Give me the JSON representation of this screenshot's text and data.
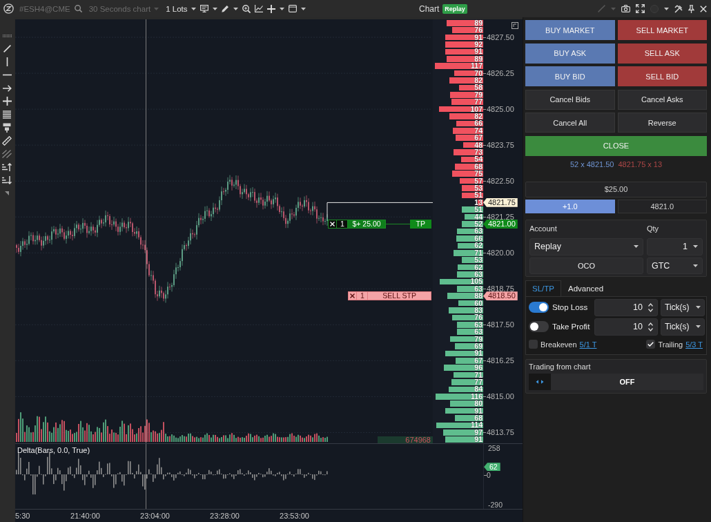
{
  "toolbar": {
    "symbol": {
      "text": "#ESH4@CME",
      "disabled": true
    },
    "timeframe": {
      "text": "30 Seconds chart",
      "disabled": true
    },
    "lots": {
      "text": "1 Lots",
      "disabled": false
    },
    "title": "Chart",
    "mode_badge": "Replay"
  },
  "chart": {
    "ladder": [
      {
        "volume": "89",
        "kind": "ask",
        "level": 0.76
      },
      {
        "volume": "76",
        "kind": "ask",
        "level": 0.65
      },
      {
        "volume": "91",
        "kind": "ask",
        "level": 0.78,
        "axis_label": {
          "text": "4827.50",
          "kind": "tick"
        }
      },
      {
        "volume": "92",
        "kind": "ask",
        "level": 0.79
      },
      {
        "volume": "91",
        "kind": "ask",
        "level": 0.78
      },
      {
        "volume": "89",
        "kind": "ask",
        "level": 0.76
      },
      {
        "volume": "117",
        "kind": "ask",
        "level": 1.0
      },
      {
        "volume": "70",
        "kind": "ask",
        "level": 0.6,
        "axis_label": {
          "text": "4826.25",
          "kind": "tick"
        }
      },
      {
        "volume": "82",
        "kind": "ask",
        "level": 0.7
      },
      {
        "volume": "58",
        "kind": "ask",
        "level": 0.5
      },
      {
        "volume": "79",
        "kind": "ask",
        "level": 0.68
      },
      {
        "volume": "77",
        "kind": "ask",
        "level": 0.66
      },
      {
        "volume": "107",
        "kind": "ask",
        "level": 0.91,
        "axis_label": {
          "text": "4825.00",
          "kind": "tick"
        }
      },
      {
        "volume": "82",
        "kind": "ask",
        "level": 0.7
      },
      {
        "volume": "66",
        "kind": "ask",
        "level": 0.56
      },
      {
        "volume": "74",
        "kind": "ask",
        "level": 0.63
      },
      {
        "volume": "67",
        "kind": "ask",
        "level": 0.57
      },
      {
        "volume": "48",
        "kind": "ask",
        "level": 0.41,
        "axis_label": {
          "text": "4823.75",
          "kind": "tick"
        }
      },
      {
        "volume": "73",
        "kind": "ask",
        "level": 0.62
      },
      {
        "volume": "54",
        "kind": "ask",
        "level": 0.46
      },
      {
        "volume": "68",
        "kind": "ask",
        "level": 0.58
      },
      {
        "volume": "75",
        "kind": "ask",
        "level": 0.64
      },
      {
        "volume": "57",
        "kind": "ask",
        "level": 0.49,
        "axis_label": {
          "text": "4822.50",
          "kind": "tick"
        }
      },
      {
        "volume": "53",
        "kind": "ask",
        "level": 0.45
      },
      {
        "volume": "51",
        "kind": "ask",
        "level": 0.44
      },
      {
        "volume": "13",
        "kind": "ask",
        "level": 0.11,
        "axis_label": {
          "text": "4821.75",
          "kind": "last"
        }
      },
      {
        "volume": "51",
        "kind": "bid",
        "level": 0.44
      },
      {
        "volume": "44",
        "kind": "bid",
        "level": 0.38,
        "axis_label": {
          "text": "4821.25",
          "kind": "tick"
        }
      },
      {
        "volume": "52",
        "kind": "bid",
        "level": 0.44,
        "axis_label": {
          "text": "4821.00",
          "kind": "take-profit"
        },
        "order": {
          "kind": "take-profit",
          "qty": "1",
          "text": "$+ 25.00",
          "tag": "TP"
        }
      },
      {
        "volume": "63",
        "kind": "bid",
        "level": 0.54
      },
      {
        "volume": "66",
        "kind": "bid",
        "level": 0.56
      },
      {
        "volume": "62",
        "kind": "bid",
        "level": 0.53
      },
      {
        "volume": "71",
        "kind": "bid",
        "level": 0.61,
        "axis_label": {
          "text": "4820.00",
          "kind": "tick"
        }
      },
      {
        "volume": "53",
        "kind": "bid",
        "level": 0.45
      },
      {
        "volume": "62",
        "kind": "bid",
        "level": 0.53
      },
      {
        "volume": "63",
        "kind": "bid",
        "level": 0.54
      },
      {
        "volume": "105",
        "kind": "bid",
        "level": 0.9
      },
      {
        "volume": "63",
        "kind": "bid",
        "level": 0.54,
        "axis_label": {
          "text": "4818.75",
          "kind": "tick"
        }
      },
      {
        "volume": "88",
        "kind": "bid",
        "level": 0.75,
        "axis_label": {
          "text": "4818.50",
          "kind": "stop"
        },
        "order": {
          "kind": "stop",
          "qty": "1",
          "text": "SELL STP"
        }
      },
      {
        "volume": "60",
        "kind": "bid",
        "level": 0.51
      },
      {
        "volume": "83",
        "kind": "bid",
        "level": 0.71
      },
      {
        "volume": "76",
        "kind": "bid",
        "level": 0.65
      },
      {
        "volume": "63",
        "kind": "bid",
        "level": 0.54,
        "axis_label": {
          "text": "4817.50",
          "kind": "tick"
        }
      },
      {
        "volume": "63",
        "kind": "bid",
        "level": 0.54
      },
      {
        "volume": "79",
        "kind": "bid",
        "level": 0.68
      },
      {
        "volume": "69",
        "kind": "bid",
        "level": 0.59
      },
      {
        "volume": "91",
        "kind": "bid",
        "level": 0.78
      },
      {
        "volume": "67",
        "kind": "bid",
        "level": 0.57,
        "axis_label": {
          "text": "4816.25",
          "kind": "tick"
        }
      },
      {
        "volume": "96",
        "kind": "bid",
        "level": 0.82
      },
      {
        "volume": "71",
        "kind": "bid",
        "level": 0.61
      },
      {
        "volume": "77",
        "kind": "bid",
        "level": 0.66
      },
      {
        "volume": "84",
        "kind": "bid",
        "level": 0.72
      },
      {
        "volume": "116",
        "kind": "bid",
        "level": 0.99,
        "axis_label": {
          "text": "4815.00",
          "kind": "tick"
        }
      },
      {
        "volume": "80",
        "kind": "bid",
        "level": 0.68
      },
      {
        "volume": "91",
        "kind": "bid",
        "level": 0.78
      },
      {
        "volume": "68",
        "kind": "bid",
        "level": 0.58
      },
      {
        "volume": "114",
        "kind": "bid",
        "level": 0.97
      },
      {
        "volume": "97",
        "kind": "bid",
        "level": 0.83,
        "axis_label": {
          "text": "4813.75",
          "kind": "tick"
        }
      },
      {
        "volume": "91",
        "kind": "bid",
        "level": 0.78
      }
    ],
    "volume_readout": "674968",
    "indicator": {
      "label": "Delta(Bars, 0.0, True)",
      "axis": [
        {
          "text": "258",
          "kind": "tick"
        },
        {
          "text": "62",
          "kind": "value"
        },
        {
          "text": "0",
          "kind": "baseline"
        },
        {
          "text": "-290",
          "kind": "tick"
        }
      ]
    },
    "time_axis": [
      "5:30",
      "21:40:00",
      "23:04:00",
      "23:28:00",
      "23:53:00"
    ]
  },
  "order_panel": {
    "buttons": [
      {
        "label": "BUY MARKET",
        "kind": "buy"
      },
      {
        "label": "SELL MARKET",
        "kind": "sell"
      },
      {
        "label": "BUY ASK",
        "kind": "buy"
      },
      {
        "label": "SELL ASK",
        "kind": "sell"
      },
      {
        "label": "BUY BID",
        "kind": "buy"
      },
      {
        "label": "SELL BID",
        "kind": "sell"
      },
      {
        "label": "Cancel Bids",
        "kind": "neutral"
      },
      {
        "label": "Cancel Asks",
        "kind": "neutral"
      },
      {
        "label": "Cancel All",
        "kind": "neutral"
      },
      {
        "label": "Reverse",
        "kind": "neutral"
      },
      {
        "label": "CLOSE",
        "kind": "close"
      }
    ],
    "bid": "52 x 4821.50",
    "ask": "4821.75 x 13",
    "pnl": "$25.00",
    "position": {
      "text": "+1.0",
      "kind": "long"
    },
    "avg_price": "4821.0",
    "account": {
      "label": "Account",
      "value": "Replay"
    },
    "qty": {
      "label": "Qty",
      "value": "1"
    },
    "oco": "OCO",
    "time_in_force": "GTC",
    "tabs": [
      {
        "label": "SL/TP",
        "selected": true
      },
      {
        "label": "Advanced",
        "selected": false
      }
    ],
    "brackets": [
      {
        "label": "Stop Loss",
        "on": true,
        "value": "10",
        "unit": "Tick(s)"
      },
      {
        "label": "Take Profit",
        "on": false,
        "value": "10",
        "unit": "Tick(s)"
      }
    ],
    "options": [
      {
        "label": "Breakeven",
        "checked": false,
        "link": "5/1 T"
      },
      {
        "label": "Trailing",
        "checked": true,
        "link": "5/3 T"
      }
    ],
    "chart_trading": {
      "label": "Trading from chart",
      "value": "OFF"
    }
  }
}
